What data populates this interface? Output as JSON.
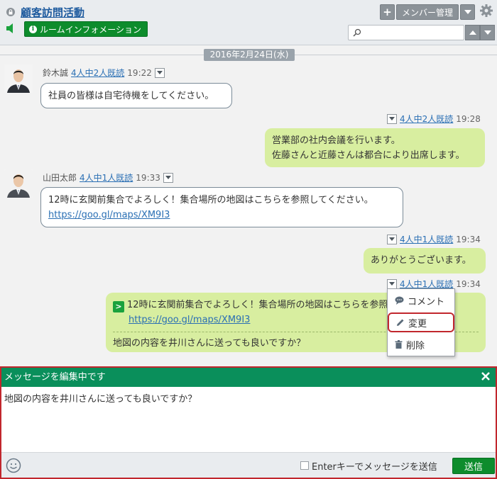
{
  "header": {
    "room_title": "顧客訪問活動",
    "info_button": "ルームインフォメーション",
    "add_button": "+",
    "members_button": "メンバー管理",
    "search_placeholder": ""
  },
  "chat": {
    "date": "2016年2月24日(水)",
    "messages": [
      {
        "side": "left",
        "sender": "鈴木誠",
        "read": "4人中2人既読",
        "time": "19:22",
        "lines": [
          "社員の皆様は自宅待機をしてください。"
        ]
      },
      {
        "side": "right",
        "read": "4人中2人既読",
        "time": "19:28",
        "lines": [
          "営業部の社内会議を行います。",
          "佐藤さんと近藤さんは都合により出席します。"
        ]
      },
      {
        "side": "left",
        "sender": "山田太郎",
        "read": "4人中1人既読",
        "time": "19:33",
        "lines": [
          "12時に玄関前集合でよろしく！集合場所の地図はこちらを参照してください。"
        ],
        "link": "https://goo.gl/maps/XM9I3"
      },
      {
        "side": "right",
        "read": "4人中1人既読",
        "time": "19:34",
        "lines": [
          "ありがとうございます。"
        ]
      },
      {
        "side": "right",
        "read": "4人中1人既読",
        "time": "19:34",
        "quote_mark": ">",
        "quote_text": "12時に玄関前集合でよろしく！集合場所の地図はこちらを参照してください。",
        "quote_link": "https://goo.gl/maps/XM9I3",
        "reply": "地図の内容を井川さんに送っても良いですか？"
      }
    ]
  },
  "context_menu": {
    "items": [
      {
        "label": "コメント",
        "icon": "comment-icon"
      },
      {
        "label": "変更",
        "icon": "pencil-icon",
        "selected": true
      },
      {
        "label": "削除",
        "icon": "trash-icon"
      }
    ]
  },
  "editor": {
    "title": "メッセージを編集中です",
    "text": "地図の内容を井川さんに送っても良いですか？",
    "enter_label": "Enterキーでメッセージを送信",
    "send_label": "送信"
  },
  "colors": {
    "green": "#0d8c2c",
    "editor_header": "#0a8f5b",
    "highlight": "#c1272d",
    "link": "#2a6fb4",
    "own_bubble": "#d8eea0"
  }
}
